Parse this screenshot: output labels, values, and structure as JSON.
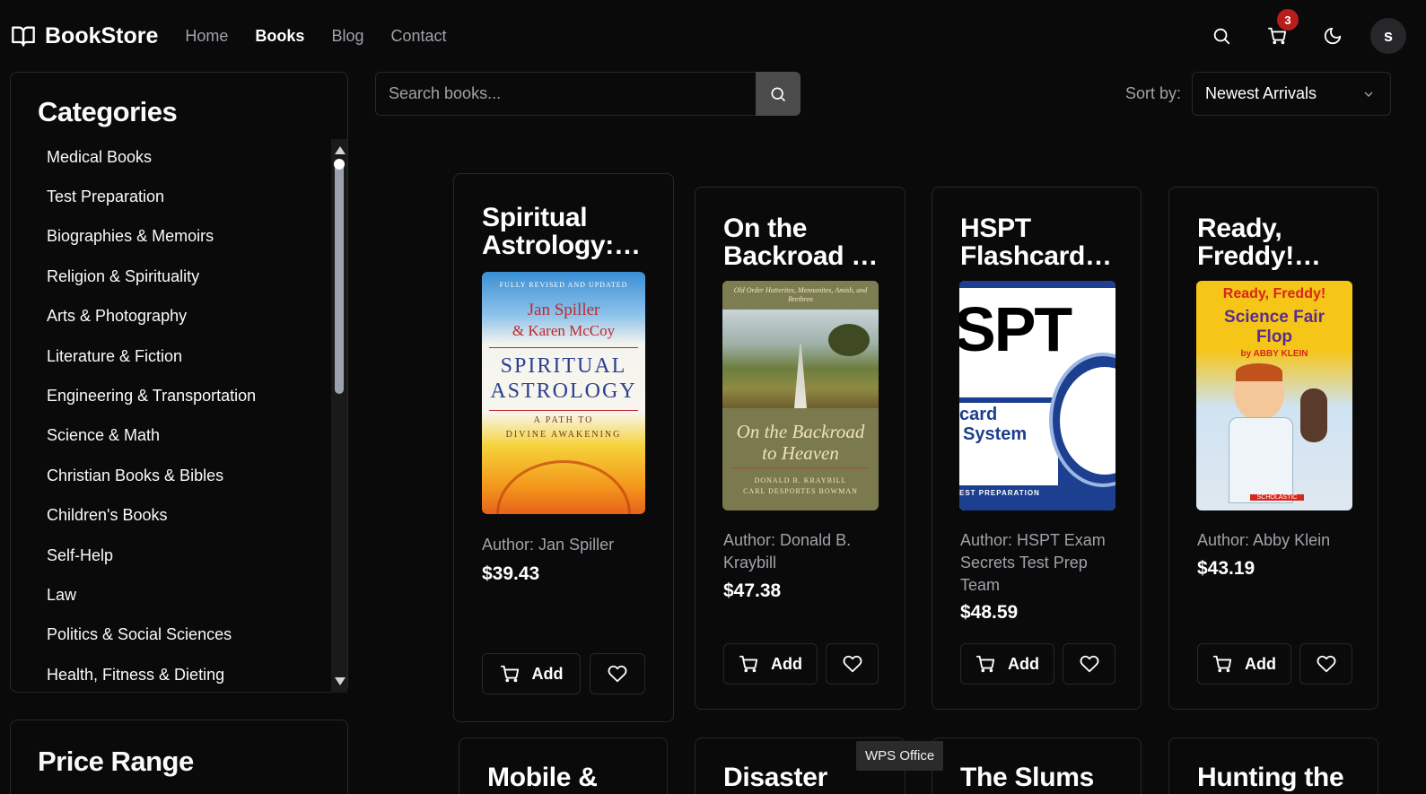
{
  "header": {
    "brand": "BookStore",
    "nav": [
      "Home",
      "Books",
      "Blog",
      "Contact"
    ],
    "active_nav": "Books",
    "cart_count": "3",
    "avatar_letter": "s"
  },
  "sidebar": {
    "categories_title": "Categories",
    "categories": [
      "Medical Books",
      "Test Preparation",
      "Biographies & Memoirs",
      "Religion & Spirituality",
      "Arts & Photography",
      "Literature & Fiction",
      "Engineering & Transportation",
      "Science & Math",
      "Christian Books & Bibles",
      "Children's Books",
      "Self-Help",
      "Law",
      "Politics & Social Sciences",
      "Health, Fitness & Dieting"
    ],
    "price_title": "Price Range"
  },
  "search": {
    "placeholder": "Search books..."
  },
  "sort": {
    "label": "Sort by:",
    "value": "Newest Arrivals"
  },
  "books": [
    {
      "title": "Spiritual Astrology:…",
      "author": "Author: Jan Spiller",
      "price": "$39.43",
      "cover": {
        "top": "FULLY REVISED AND UPDATED",
        "authors1": "Jan Spiller",
        "authors2": "& Karen McCoy",
        "t1": "SPIRITUAL",
        "t2": "ASTROLOGY",
        "sub1": "A PATH TO",
        "sub2": "DIVINE AWAKENING"
      }
    },
    {
      "title": "On the Backroad …",
      "author": "Author: Donald B. Kraybill",
      "price": "$47.38",
      "cover": {
        "top": "Old Order Hutterites, Mennonites, Amish, and Brethren",
        "t1": "On the Backroad",
        "t2": "to Heaven",
        "sub1": "DONALD B. KRAYBILL",
        "sub2": "CARL DESPORTES BOWMAN"
      }
    },
    {
      "title": "HSPT Flashcard…",
      "author": "Author: HSPT Exam Secrets Test Prep Team",
      "price": "$48.59",
      "cover": {
        "t1": "SPT",
        "t2": "card",
        "t3": "System",
        "sub1": "EST PREPARATION"
      }
    },
    {
      "title": "Ready, Freddy!…",
      "author": "Author: Abby Klein",
      "price": "$43.19",
      "cover": {
        "t1": "Ready, Freddy!",
        "t2": "Science Fair",
        "t3": "Flop",
        "sub1": "by ABBY KLEIN",
        "sub2": "SCHOLASTIC"
      }
    }
  ],
  "next_row_titles": [
    "Mobile &",
    "Disaster",
    "The Slums",
    "Hunting the"
  ],
  "add_label": "Add",
  "tooltip": "WPS Office"
}
